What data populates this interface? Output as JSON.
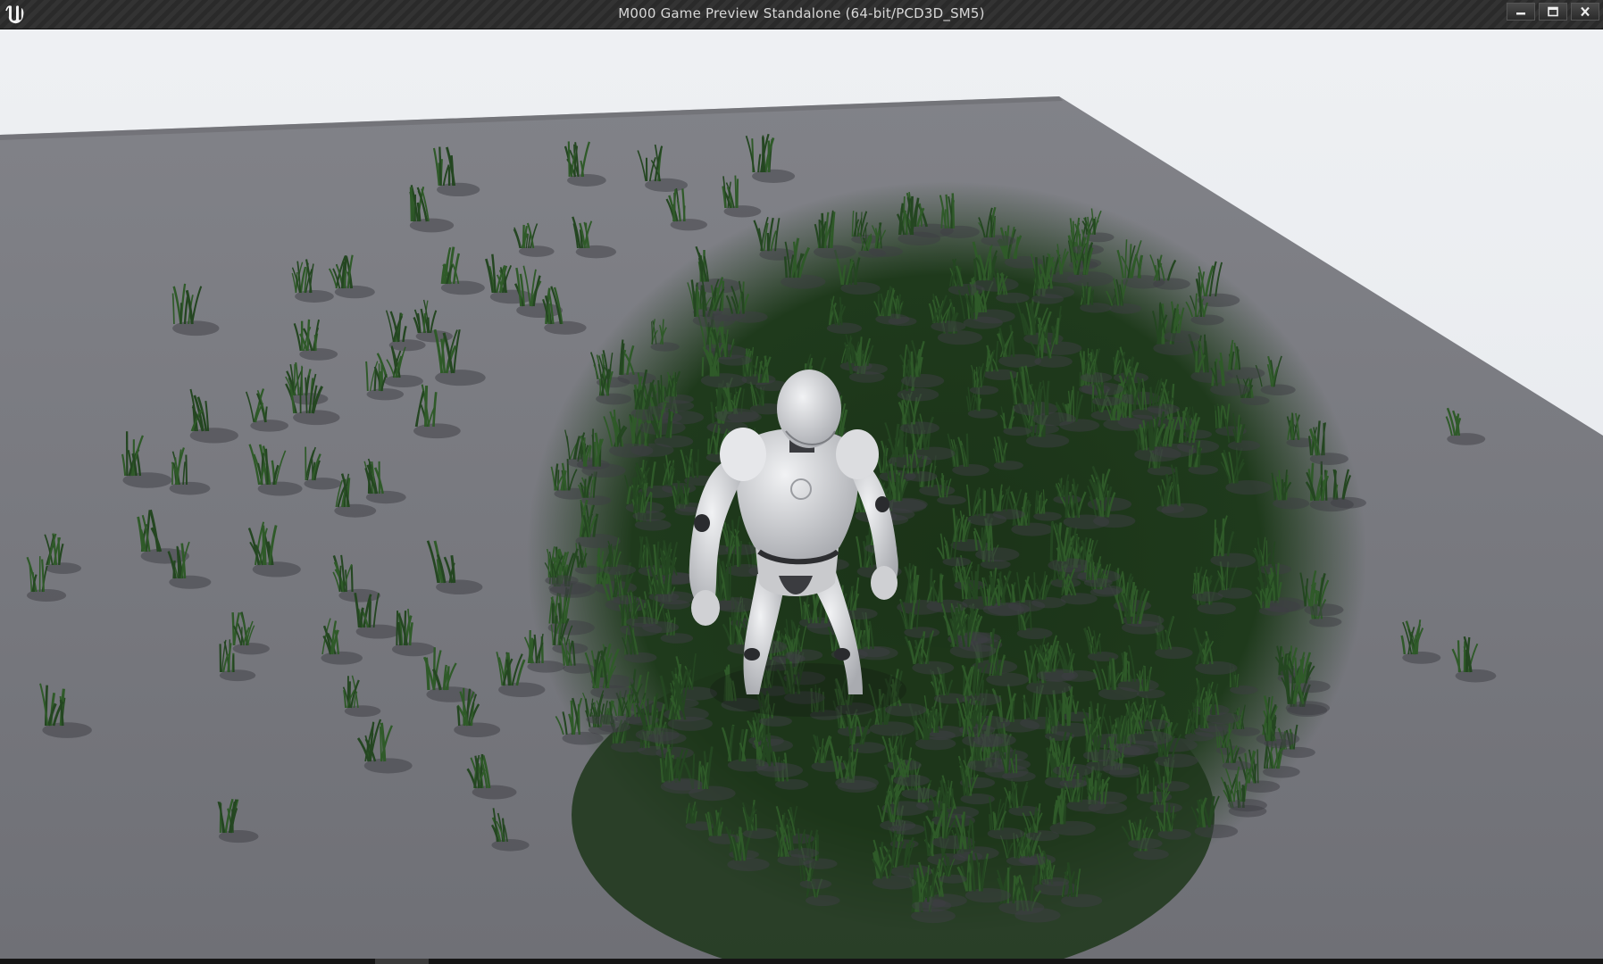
{
  "window": {
    "title": "M000 Game Preview Standalone (64-bit/PCD3D_SM5)",
    "logo_icon": "unreal-engine-logo-icon",
    "controls": {
      "minimize_icon": "minimize-icon",
      "maximize_icon": "maximize-icon",
      "close_icon": "close-icon"
    }
  },
  "viewport": {
    "sky_color": "#e6e9ee",
    "floor_color": "#76777d",
    "grass_color": "#1f3a1c",
    "character_color": "#d9dadd"
  }
}
